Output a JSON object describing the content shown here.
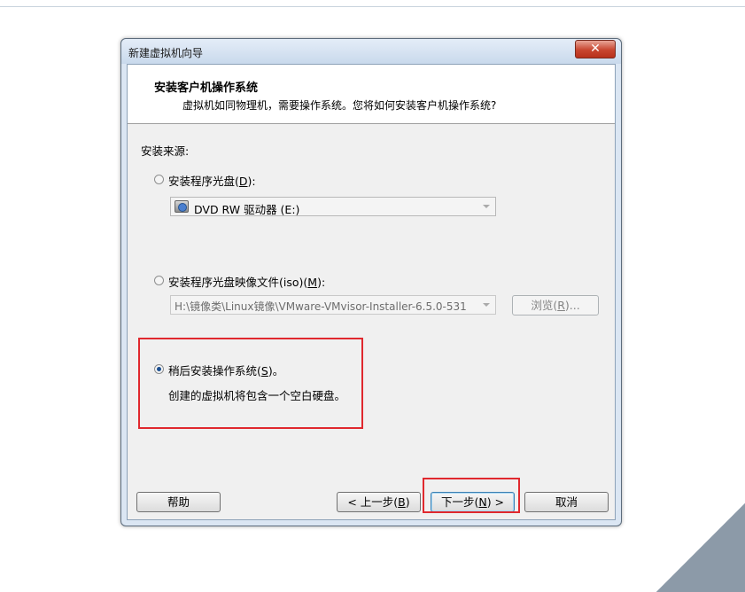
{
  "window": {
    "title": "新建虚拟机向导",
    "close_glyph": "✕"
  },
  "header": {
    "title": "安装客户机操作系统",
    "description": "虚拟机如同物理机，需要操作系统。您将如何安装客户机操作系统?"
  },
  "install_source": {
    "label": "安装来源:",
    "options": [
      {
        "prefix": "安装程序光盘(",
        "key": "D",
        "suffix": "):",
        "selected": false
      },
      {
        "prefix": "安装程序光盘映像文件(iso)(",
        "key": "M",
        "suffix": "):",
        "selected": false
      },
      {
        "prefix": "稍后安装操作系统(",
        "key": "S",
        "suffix": ")。",
        "selected": true
      }
    ],
    "disc_drive": {
      "value": "DVD RW 驱动器 (E:)",
      "icon": "disc-drive-icon"
    },
    "iso_path": {
      "value": "H:\\镜像类\\Linux镜像\\VMware-VMvisor-Installer-6.5.0-531"
    },
    "browse": {
      "prefix": "浏览(",
      "key": "R",
      "suffix": ")..."
    },
    "later_description": "创建的虚拟机将包含一个空白硬盘。"
  },
  "footer": {
    "help": "帮助",
    "back": {
      "prefix": "< 上一步(",
      "key": "B",
      "suffix": ")"
    },
    "next": {
      "prefix": "下一步(",
      "key": "N",
      "suffix": ") >"
    },
    "cancel": "取消"
  },
  "highlight_color": "#e0282e"
}
